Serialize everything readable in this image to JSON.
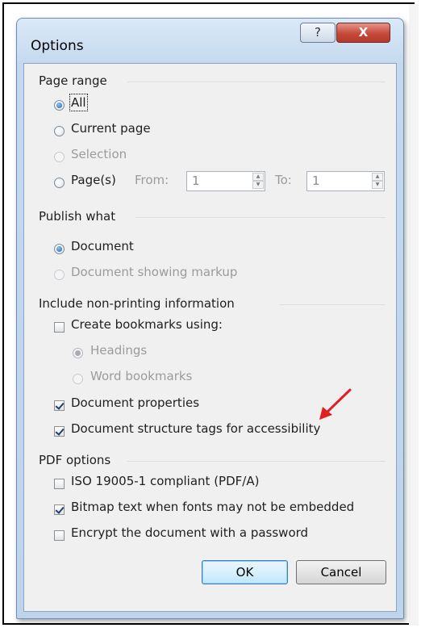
{
  "window": {
    "title": "Options",
    "help_label": "?",
    "close_label": "X"
  },
  "page_range": {
    "heading": "Page range",
    "all": "All",
    "current_page": "Current page",
    "selection": "Selection",
    "pages": "Page(s)",
    "from_label": "From:",
    "from_value": "1",
    "to_label": "To:",
    "to_value": "1"
  },
  "publish_what": {
    "heading": "Publish what",
    "document": "Document",
    "document_markup": "Document showing markup"
  },
  "non_printing": {
    "heading": "Include non-printing information",
    "create_bookmarks": "Create bookmarks using:",
    "headings": "Headings",
    "word_bookmarks": "Word bookmarks",
    "doc_properties": "Document properties",
    "structure_tags": "Document structure tags for accessibility"
  },
  "pdf_options": {
    "heading": "PDF options",
    "iso": "ISO 19005-1 compliant (PDF/A)",
    "bitmap": "Bitmap text when fonts may not be embedded",
    "encrypt": "Encrypt the document with a password"
  },
  "buttons": {
    "ok": "OK",
    "cancel": "Cancel"
  },
  "colors": {
    "annotation_arrow": "#e02020",
    "title_bar": "#c4d9ef",
    "close_button": "#c6493a"
  }
}
